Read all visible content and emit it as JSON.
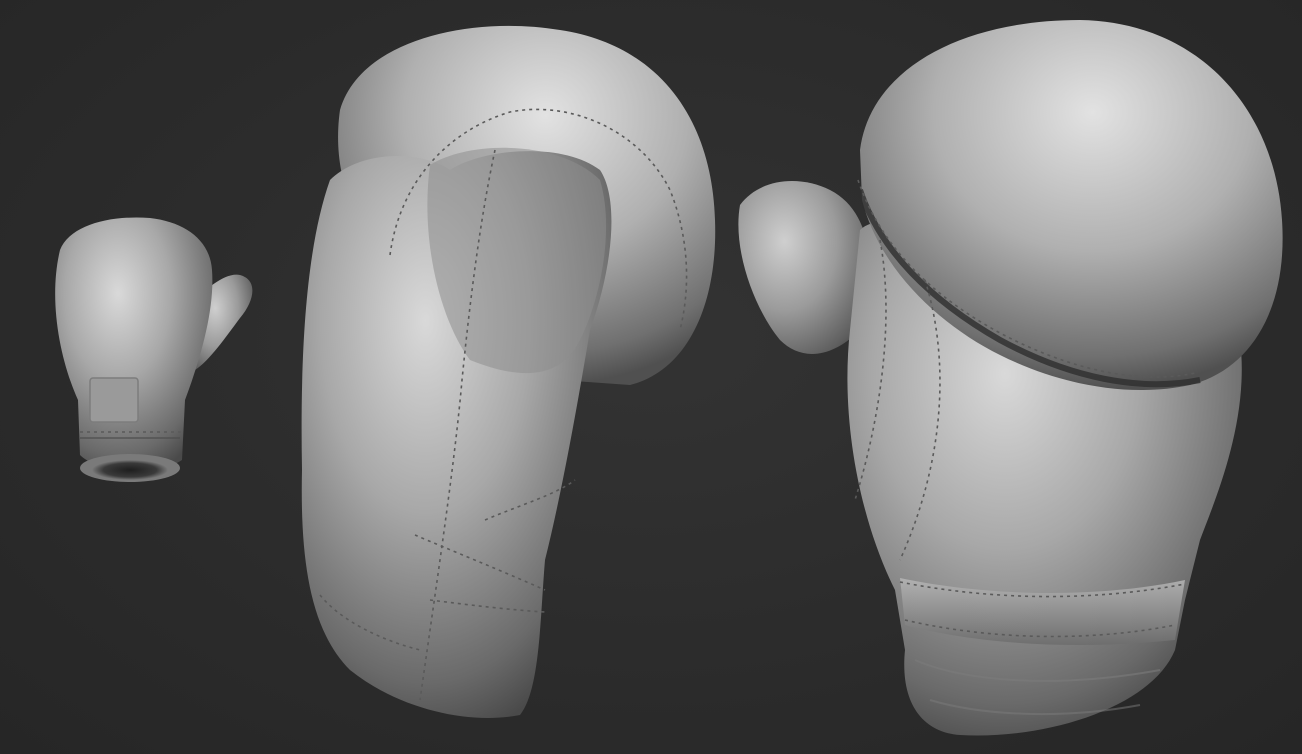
{
  "scene": {
    "background_color": "#2c2c2c",
    "surface_color": "#a9a9a9",
    "objects": [
      {
        "name": "small-glove-mitten",
        "stitched": true
      },
      {
        "name": "large-glove-side",
        "stitched": true
      },
      {
        "name": "large-glove-front",
        "stitched": true
      }
    ]
  }
}
